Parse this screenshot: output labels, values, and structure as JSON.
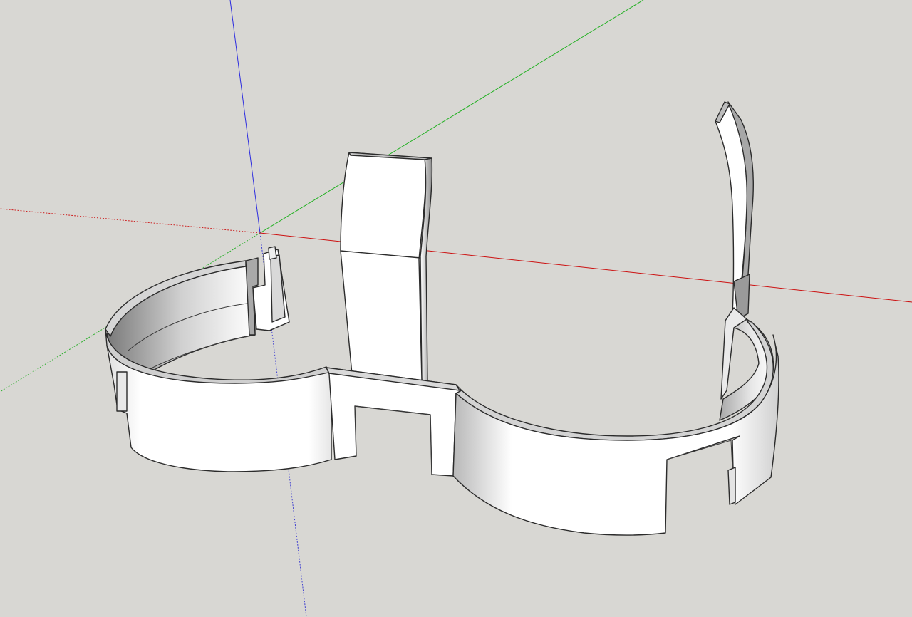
{
  "viewport": {
    "background": "#d8d7d3",
    "axes": {
      "red_axis_color": "#cc0000",
      "green_axis_color": "#00aa00",
      "blue_axis_color": "#0000cc"
    },
    "model": {
      "face_color": "#ffffff",
      "shade_color": "#8c8c8c",
      "edge_color": "#2b2b2b"
    }
  }
}
